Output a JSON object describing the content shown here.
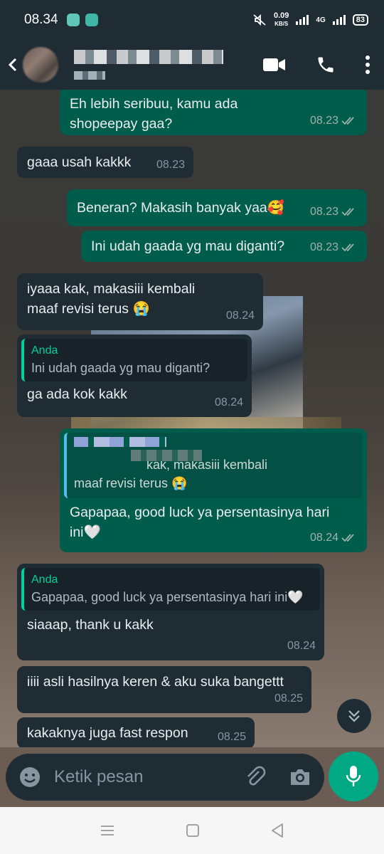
{
  "status_bar": {
    "time": "08.34",
    "speed_value": "0.09",
    "speed_unit": "KB/S",
    "network": "4G",
    "battery": "83"
  },
  "header": {
    "icons": [
      "back-arrow-icon",
      "video-call-icon",
      "phone-icon",
      "more-icon"
    ]
  },
  "messages": [
    {
      "dir": "out",
      "text": "Eh lebih seribuu, kamu ada shopeepay gaa?",
      "time": "08.23"
    },
    {
      "dir": "in",
      "text": "gaaa usah kakkk",
      "time": "08.23"
    },
    {
      "dir": "out",
      "text": "Beneran? Makasih banyak yaa🥰",
      "time": "08.23"
    },
    {
      "dir": "out",
      "text": "Ini udah gaada yg mau diganti?",
      "time": "08.23"
    },
    {
      "dir": "in",
      "text": "iyaaa kak, makasiii kembali\nmaaf revisi terus 😭",
      "time": "08.24"
    },
    {
      "dir": "in",
      "quote_author": "Anda",
      "quote_text": "Ini udah gaada yg mau diganti?",
      "text": "ga ada kok kakk",
      "time": "08.24"
    },
    {
      "dir": "out",
      "quote_text_1": "kak, makasiii kembali",
      "quote_text_2": "maaf revisi terus 😭",
      "text": "Gapapaa, good luck ya persentasinya hari ini🤍",
      "time": "08.24"
    },
    {
      "dir": "in",
      "quote_author": "Anda",
      "quote_text": "Gapapaa, good luck ya persentasinya hari ini🤍",
      "text": "siaaap, thank u kakk",
      "time": "08.24"
    },
    {
      "dir": "in",
      "text": "iiii asli hasilnya keren & aku suka bangettt",
      "time": "08.25"
    },
    {
      "dir": "in",
      "text": "kakaknya juga fast respon",
      "time": "08.25"
    }
  ],
  "input": {
    "placeholder": "Ketik pesan"
  },
  "colors": {
    "incoming_bubble": "#1f2c34",
    "outgoing_bubble": "#005c4b",
    "accent": "#00a884"
  }
}
